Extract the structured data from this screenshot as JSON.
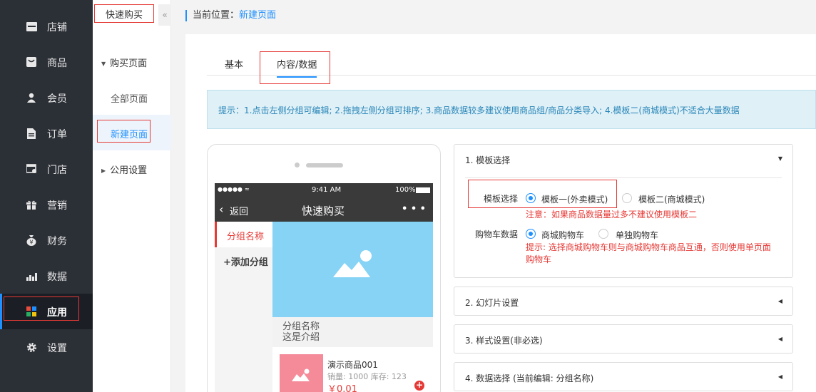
{
  "nav": {
    "items": [
      {
        "label": "店铺",
        "icon": "store-icon"
      },
      {
        "label": "商品",
        "icon": "goods-icon"
      },
      {
        "label": "会员",
        "icon": "member-icon"
      },
      {
        "label": "订单",
        "icon": "order-icon"
      },
      {
        "label": "门店",
        "icon": "shop-icon"
      },
      {
        "label": "营销",
        "icon": "gift-icon"
      },
      {
        "label": "财务",
        "icon": "money-bag-icon"
      },
      {
        "label": "数据",
        "icon": "chart-icon"
      },
      {
        "label": "应用",
        "icon": "apps-icon"
      },
      {
        "label": "设置",
        "icon": "gear-icon"
      }
    ],
    "active": "应用"
  },
  "subnav": {
    "title": "快速购买",
    "collapse_icon": "«",
    "group1": "购买页面",
    "link_all": "全部页面",
    "link_new": "新建页面",
    "group2": "公用设置"
  },
  "breadcrumb": {
    "prefix": "当前位置：",
    "current": "新建页面"
  },
  "tabs": {
    "basic": "基本",
    "content": "内容/数据"
  },
  "tip": "提示：1.点击左侧分组可编辑; 2.拖拽左侧分组可排序; 3.商品数据较多建议使用商品组/商品分类导入; 4.模板二(商城模式)不适合大量数据",
  "phone": {
    "signal": "●●●●● ",
    "time": "9:41 AM",
    "battery": "100%",
    "back": "返回",
    "title": "快速购买",
    "more": "• • •",
    "category": "分组名称",
    "add_group": "+添加分组",
    "group_name": "分组名称",
    "group_desc": "这是介绍",
    "product": {
      "name": "演示商品001",
      "stats": "销量: 1000 库存: 123",
      "price": "￥0.01",
      "add": "+"
    }
  },
  "settings": {
    "template_section": "1. 模板选择",
    "template_label": "模板选择",
    "template_opt1": "模板一(外卖模式)",
    "template_opt2": "模板二(商城模式)",
    "template_note": "注意：如果商品数据量过多不建议使用模板二",
    "cart_label": "购物车数据",
    "cart_opt1": "商城购物车",
    "cart_opt2": "单独购物车",
    "cart_note_line1": "提示: 选择商城购物车则与商城购物车商品互通，否则使用单页面",
    "cart_note_line2": "购物车",
    "slide_section": "2. 幻灯片设置",
    "style_section": "3. 样式设置(非必选)",
    "data_section": "4. 数据选择 (当前编辑: 分组名称)"
  },
  "colors": {
    "nav_bg": "#2b2f36",
    "accent": "#1e90ff",
    "danger": "#e53935",
    "tip_bg": "#dff0f7",
    "banner": "#87d3f5",
    "thumb": "#f58a99"
  }
}
